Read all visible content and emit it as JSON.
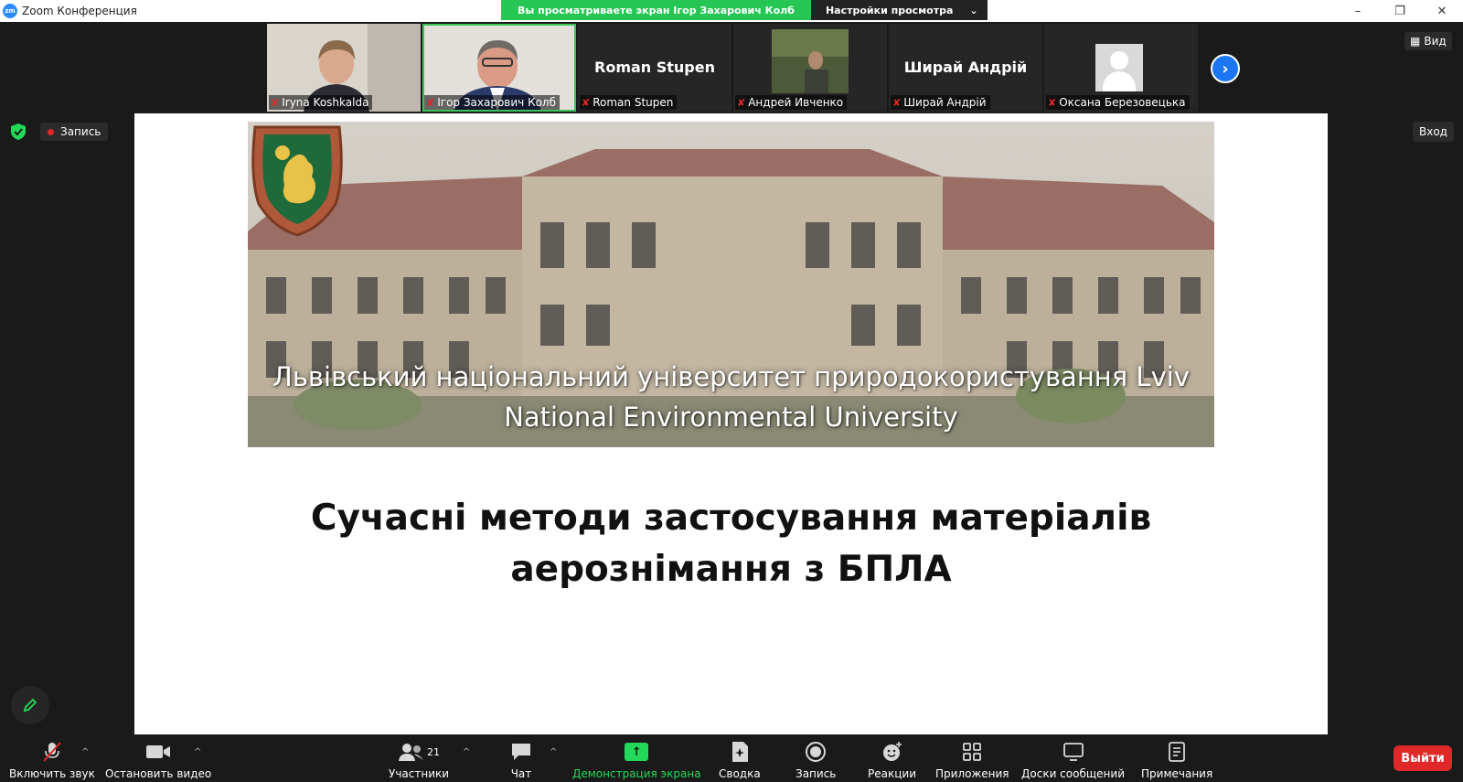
{
  "window": {
    "app_logo": "zm",
    "title": "Zoom Конференция",
    "minimize": "–",
    "maximize": "❐",
    "close": "✕"
  },
  "share_banner": {
    "viewing_text": "Вы просматриваете экран Ігор Захарович Колб",
    "settings_label": "Настройки просмотра",
    "settings_caret": "⌄"
  },
  "participants_strip": [
    {
      "name": "Iryna Koshkalda",
      "type": "video"
    },
    {
      "name": "Ігор Захарович Колб",
      "type": "video",
      "active": true
    },
    {
      "name": "Roman Stupen",
      "type": "name"
    },
    {
      "name": "Андрей Ивченко",
      "type": "video"
    },
    {
      "name": "Ширай Андрій",
      "type": "name"
    },
    {
      "name": "Оксана Березовецька",
      "type": "avatar"
    }
  ],
  "strip_next": "›",
  "view_button": {
    "icon": "grid-icon",
    "label": "Вид"
  },
  "enter_button": "Вход",
  "recording_label": "Запись",
  "slide": {
    "university_line1": "Львівський національний університет природокористування Lviv",
    "university_line2": "National Environmental University",
    "title_line1": "Сучасні методи застосування матеріалів",
    "title_line2": "аерознімання з БПЛА"
  },
  "toolbar": {
    "audio": "Включить звук",
    "video": "Остановить видео",
    "participants": "Участники",
    "participants_count": "21",
    "chat": "Чат",
    "share": "Демонстрация экрана",
    "summary": "Сводка",
    "record": "Запись",
    "reactions": "Реакции",
    "apps": "Приложения",
    "whiteboards": "Доски сообщений",
    "notes": "Примечания",
    "leave": "Выйти",
    "caret": "^"
  },
  "colors": {
    "accent_green": "#23d959",
    "accent_blue": "#1a76f2",
    "danger_red": "#e02828",
    "background": "#1a1a1a"
  }
}
